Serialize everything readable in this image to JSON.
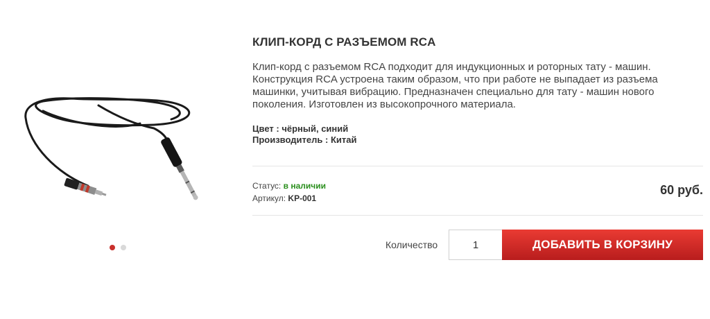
{
  "product": {
    "title": "КЛИП-КОРД С РАЗЪЕМОМ RCA",
    "description": "Клип-корд с разъемом RCA подходит для индукционных и роторных тату - машин. Конструкция RCA устроена таким образом, что при работе не выпадает из разъема машинки, учитывая вибрацию. Предназначен специально для тату - машин нового поколения. Изготовлен из высокопрочного материала.",
    "color_label": "Цвет :",
    "color_value": "чёрный, синий",
    "maker_label": "Производитель :",
    "maker_value": "Китай",
    "image_alt": "clip-cord-rca"
  },
  "gallery": {
    "active_index": 0,
    "dots_count": 2
  },
  "status": {
    "status_label": "Статус:",
    "status_value": "в наличии",
    "sku_label": "Артикул:",
    "sku_value": "KP-001"
  },
  "price": "60 руб.",
  "cart": {
    "qty_label": "Количество",
    "qty_value": "1",
    "add_button": "ДОБАВИТЬ В КОРЗИНУ"
  },
  "colors": {
    "accent": "#c9302c",
    "in_stock": "#2a8f1d"
  }
}
